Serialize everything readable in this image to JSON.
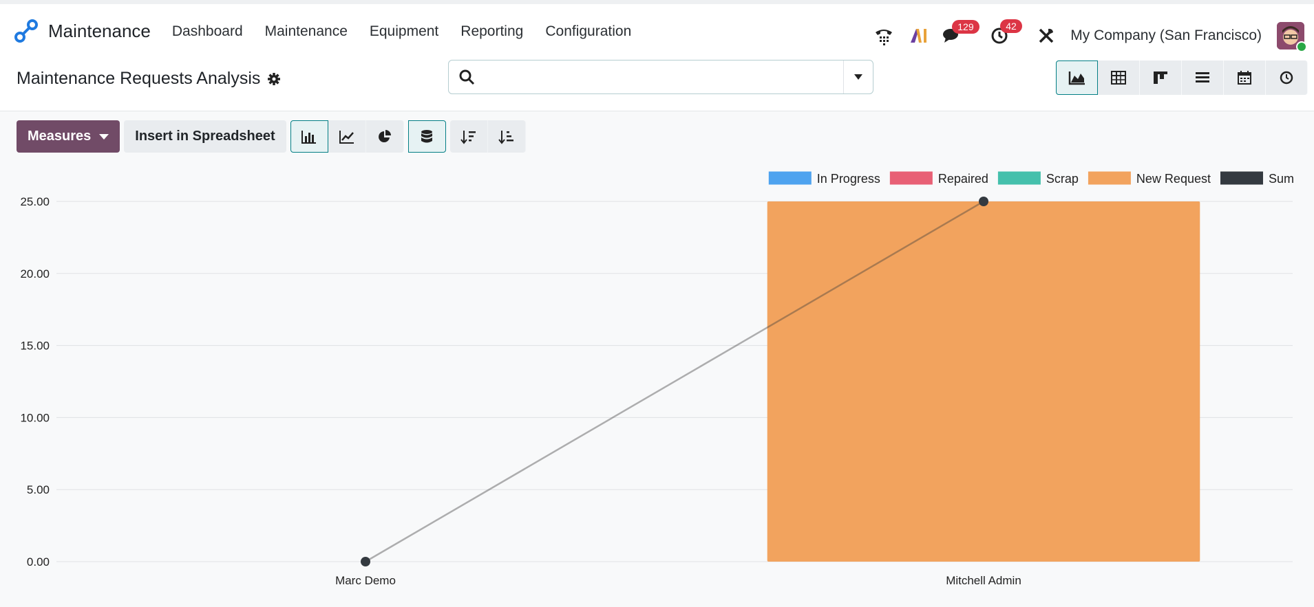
{
  "app": {
    "title": "Maintenance",
    "menu": [
      "Dashboard",
      "Maintenance",
      "Equipment",
      "Reporting",
      "Configuration"
    ],
    "systray": {
      "messages_badge": "129",
      "activities_badge": "42",
      "company": "My Company (San Francisco)"
    }
  },
  "control_panel": {
    "title": "Maintenance Requests Analysis",
    "search_placeholder": "",
    "views": [
      "graph",
      "pivot",
      "kanban",
      "list",
      "calendar",
      "activity"
    ]
  },
  "toolbar": {
    "measures_label": "Measures",
    "insert_label": "Insert in Spreadsheet"
  },
  "colors": {
    "accent": "#714b67",
    "teal": "#017e84",
    "in_progress": "#4ea3ef",
    "repaired": "#e86075",
    "scrap": "#45c0ac",
    "new_request": "#f2a35e",
    "sum": "#343a40"
  },
  "chart_data": {
    "type": "bar",
    "stacked": true,
    "categories": [
      "Marc Demo",
      "Mitchell Admin"
    ],
    "series": [
      {
        "name": "In Progress",
        "values": [
          0,
          0
        ],
        "color": "#4ea3ef"
      },
      {
        "name": "Repaired",
        "values": [
          0,
          0
        ],
        "color": "#e86075"
      },
      {
        "name": "Scrap",
        "values": [
          0,
          0
        ],
        "color": "#45c0ac"
      },
      {
        "name": "New Request",
        "values": [
          0,
          25
        ],
        "color": "#f2a35e"
      },
      {
        "name": "Sum",
        "values": [
          0,
          25
        ],
        "color": "#343a40",
        "render": "line"
      }
    ],
    "yticks": [
      "0.00",
      "5.00",
      "10.00",
      "15.00",
      "20.00",
      "25.00"
    ],
    "ylim": [
      0,
      25
    ],
    "legend": "top-right",
    "grid": true
  }
}
